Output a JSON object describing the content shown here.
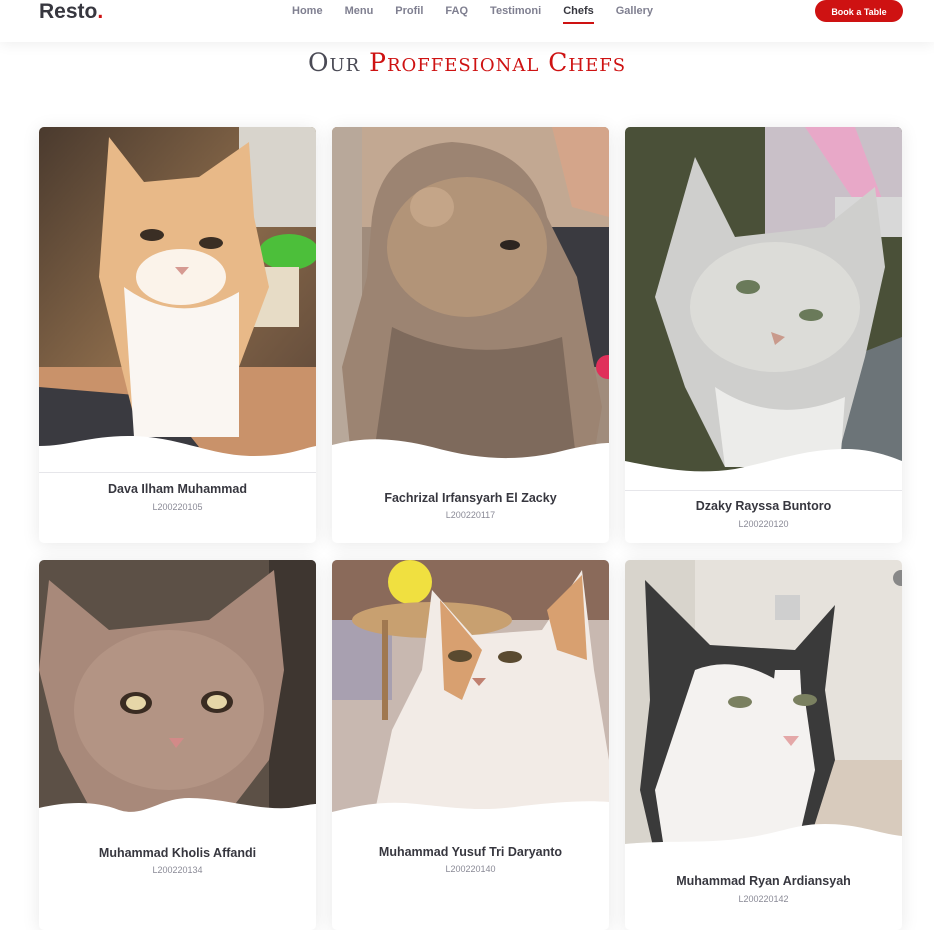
{
  "header": {
    "logo": "Resto",
    "logo_dot": ".",
    "nav": [
      "Home",
      "Menu",
      "Profil",
      "FAQ",
      "Testimoni",
      "Chefs",
      "Gallery"
    ],
    "active_nav": "Chefs",
    "cta": "Book a Table"
  },
  "section": {
    "title_part1": "Our",
    "title_part2": "Proffesional Chefs"
  },
  "chefs": [
    {
      "name": "Dava Ilham Muhammad",
      "id": "L200220105",
      "photo": "orange-white grumpy cat"
    },
    {
      "name": "Fachrizal Irfansyarh El Zacky",
      "id": "L200220117",
      "photo": "grey fluffy fold cat"
    },
    {
      "name": "Dzaky Rayssa Buntoro",
      "id": "L200220120",
      "photo": "silver grey cat"
    },
    {
      "name": "Muhammad Kholis Affandi",
      "id": "L200220134",
      "photo": "grumpy brown cat"
    },
    {
      "name": "Muhammad Yusuf Tri Daryanto",
      "id": "L200220140",
      "photo": "orange and white fluffy cat"
    },
    {
      "name": "Muhammad Ryan Ardiansyah",
      "id": "L200220142",
      "photo": "black and white cat"
    }
  ],
  "fragment_text": "13",
  "colors": {
    "accent": "#ce1212",
    "text": "#37373f",
    "muted": "#7f7f90"
  }
}
